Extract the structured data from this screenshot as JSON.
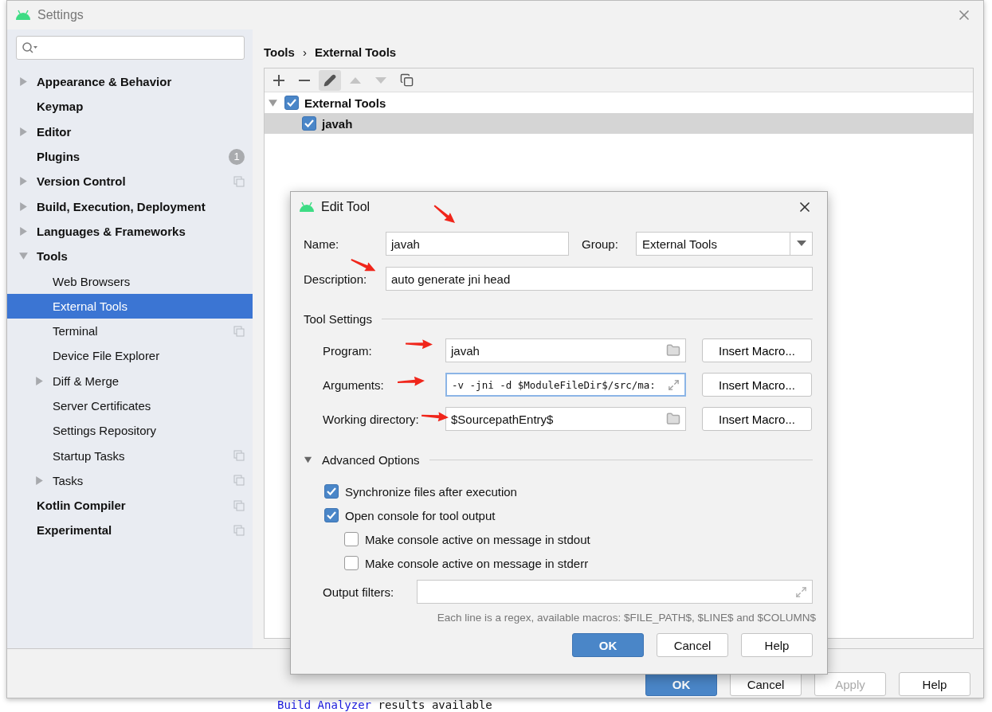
{
  "window": {
    "title": "Settings"
  },
  "sidebar": {
    "items": [
      {
        "label": "Appearance & Behavior",
        "expanded": false,
        "selected": false
      },
      {
        "label": "Keymap",
        "selected": false
      },
      {
        "label": "Editor",
        "expanded": false,
        "selected": false
      },
      {
        "label": "Plugins",
        "badge": "1",
        "selected": false
      },
      {
        "label": "Version Control",
        "expanded": false,
        "scoped": true,
        "selected": false
      },
      {
        "label": "Build, Execution, Deployment",
        "expanded": false,
        "selected": false
      },
      {
        "label": "Languages & Frameworks",
        "expanded": false,
        "selected": false
      },
      {
        "label": "Tools",
        "expanded": true,
        "selected": false,
        "children": [
          {
            "label": "Web Browsers",
            "selected": false
          },
          {
            "label": "External Tools",
            "selected": true
          },
          {
            "label": "Terminal",
            "scoped": true,
            "selected": false
          },
          {
            "label": "Device File Explorer",
            "selected": false
          },
          {
            "label": "Diff & Merge",
            "expanded": false,
            "selected": false
          },
          {
            "label": "Server Certificates",
            "selected": false
          },
          {
            "label": "Settings Repository",
            "selected": false
          },
          {
            "label": "Startup Tasks",
            "scoped": true,
            "selected": false
          },
          {
            "label": "Tasks",
            "expanded": false,
            "scoped": true,
            "selected": false
          }
        ]
      },
      {
        "label": "Kotlin Compiler",
        "scoped": true,
        "selected": false
      },
      {
        "label": "Experimental",
        "scoped": true,
        "selected": false
      }
    ]
  },
  "breadcrumb": {
    "items": [
      "Tools",
      "External Tools"
    ],
    "separator": "›"
  },
  "toolbar": [
    {
      "kind": "add",
      "selected": false,
      "disabled": false
    },
    {
      "kind": "remove",
      "selected": false,
      "disabled": false
    },
    {
      "kind": "edit",
      "selected": true,
      "disabled": false
    },
    {
      "kind": "up",
      "selected": false,
      "disabled": true
    },
    {
      "kind": "down",
      "selected": false,
      "disabled": true
    },
    {
      "kind": "copy",
      "selected": false,
      "disabled": false
    }
  ],
  "tools_tree": [
    {
      "label": "External Tools",
      "checked": true,
      "expanded": true,
      "selected": false,
      "children": [
        {
          "label": "javah",
          "checked": true,
          "selected": true
        }
      ]
    }
  ],
  "dialog": {
    "title": "Edit Tool",
    "name": {
      "label": "Name:",
      "value": "javah"
    },
    "group": {
      "label": "Group:",
      "value": "External Tools"
    },
    "description": {
      "label": "Description:",
      "value": "auto generate jni head"
    },
    "tool_settings": {
      "title": "Tool Settings",
      "fields": [
        {
          "label": "Program:",
          "value": "javah",
          "kind": "folder",
          "focused": false,
          "button": "Insert Macro..."
        },
        {
          "label": "Arguments:",
          "value": "-v -jni -d $ModuleFileDir$/src/ma:",
          "kind": "expand",
          "focused": true,
          "button": "Insert Macro..."
        },
        {
          "label": "Working directory:",
          "value": "$SourcepathEntry$",
          "kind": "folder",
          "focused": false,
          "button": "Insert Macro..."
        }
      ]
    },
    "advanced": {
      "title": "Advanced Options",
      "expanded": true,
      "options": [
        {
          "label": "Synchronize files after execution",
          "checked": true
        },
        {
          "label": "Open console for tool output",
          "checked": true,
          "children": [
            {
              "label": "Make console active on message in stdout",
              "checked": false
            },
            {
              "label": "Make console active on message in stderr",
              "checked": false
            }
          ]
        }
      ],
      "output_filters": {
        "label": "Output filters:"
      },
      "hint": "Each line is a regex, available macros: $FILE_PATH$, $LINE$ and $COLUMN$"
    },
    "buttons": [
      {
        "label": "OK",
        "primary": true
      },
      {
        "label": "Cancel",
        "primary": false
      },
      {
        "label": "Help",
        "primary": false
      }
    ]
  },
  "footer_buttons": [
    {
      "label": "OK",
      "primary": true,
      "disabled": false
    },
    {
      "label": "Cancel",
      "primary": false,
      "disabled": false
    },
    {
      "label": "Apply",
      "primary": false,
      "disabled": true
    },
    {
      "label": "Help",
      "primary": false,
      "disabled": false
    }
  ],
  "console_line": {
    "link": "Build Analyzer",
    "text": "results available"
  }
}
